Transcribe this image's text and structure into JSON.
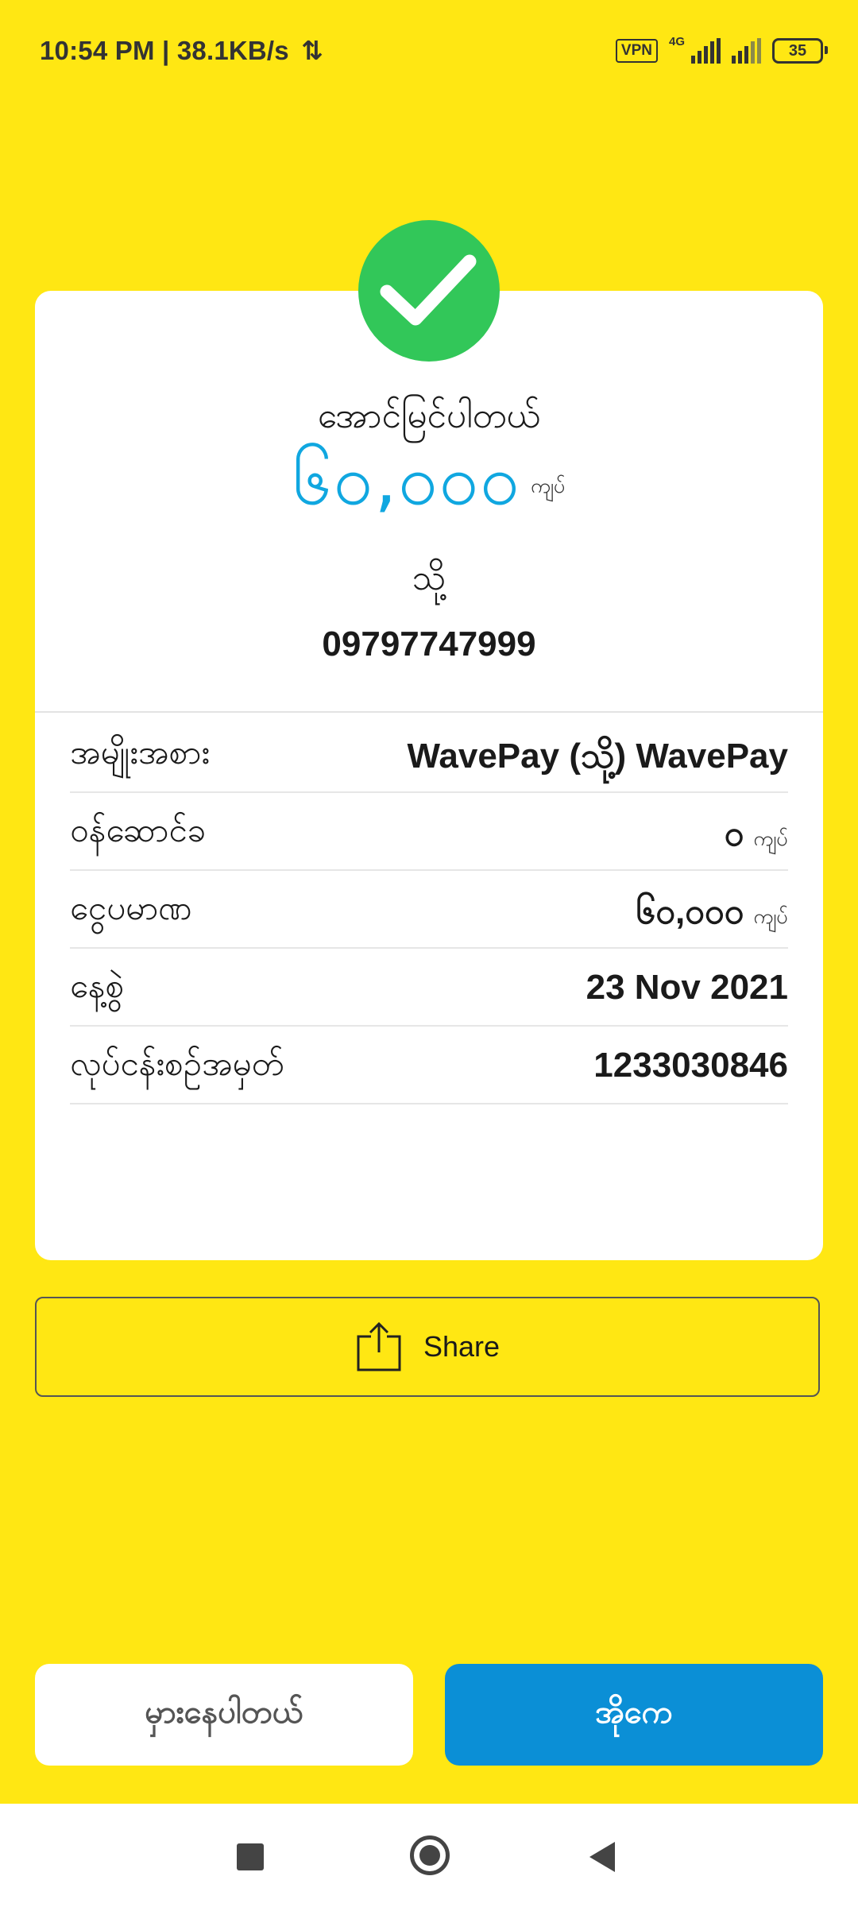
{
  "status_bar": {
    "time_speed": "10:54 PM | 38.1KB/s",
    "vpn": "VPN",
    "network": "4G",
    "battery": "35"
  },
  "receipt": {
    "status": "အောင်မြင်ပါတယ်",
    "amount": "၆၀,၀၀၀",
    "amount_unit": "ကျပ်",
    "to_label": "သို့",
    "recipient_number": "09797747999",
    "details": [
      {
        "label": "အမျိုးအစား",
        "value": "WavePay (သို့) WavePay",
        "unit": ""
      },
      {
        "label": "ဝန်ဆောင်ခ",
        "value": "၀",
        "unit": "ကျပ်"
      },
      {
        "label": "ငွေပမာဏ",
        "value": "၆၀,၀၀၀",
        "unit": "ကျပ်"
      },
      {
        "label": "နေ့စွဲ",
        "value": "23 Nov 2021",
        "unit": ""
      },
      {
        "label": "လုပ်ငန်းစဉ်အမှတ်",
        "value": "1233030846",
        "unit": ""
      }
    ]
  },
  "share": {
    "label": "Share"
  },
  "actions": {
    "wrong_label": "မှားနေပါတယ်",
    "ok_label": "အိုကေ"
  },
  "icons": {
    "success": "checkmark-icon",
    "share": "share-upload-icon"
  },
  "colors": {
    "background": "#FFE713",
    "success_green": "#32C759",
    "amount_blue": "#10A7E0",
    "primary_button": "#0B8FD6"
  }
}
